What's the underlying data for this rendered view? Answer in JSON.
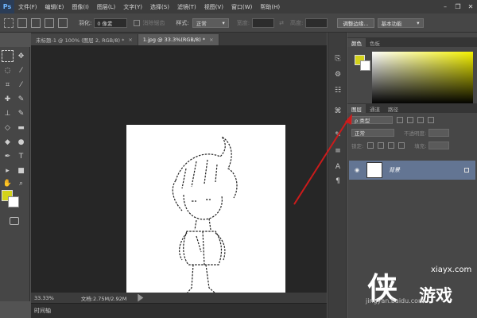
{
  "app": {
    "logo_text": "Ps"
  },
  "menu": {
    "items": [
      "文件(F)",
      "编辑(E)",
      "图像(I)",
      "图层(L)",
      "文字(Y)",
      "选择(S)",
      "滤镜(T)",
      "视图(V)",
      "窗口(W)",
      "帮助(H)"
    ]
  },
  "window_controls": {
    "minimize": "–",
    "restore": "❐",
    "close": "✕"
  },
  "options": {
    "feather_label": "羽化:",
    "feather_value": "0 像素",
    "antialias_label": "消除锯齿",
    "style_label": "样式:",
    "style_value": "正常",
    "width_label": "宽度:",
    "height_label": "高度:",
    "refine_edge": "调整边缘...",
    "workspace": "基本功能"
  },
  "tabs": [
    {
      "label": "未标题-1 @ 100% (图层 2, RGB/8) *",
      "close": "×"
    },
    {
      "label": "1.jpg @ 33.3%(RGB/8) *",
      "close": "×"
    }
  ],
  "status": {
    "zoom": "33.33%",
    "doc_size": "文档:2.75M/2.92M"
  },
  "timeline": {
    "label": "时间轴"
  },
  "colors": {
    "foreground": "#d4d31a",
    "background": "#ffffff",
    "layer_selected": "#637593",
    "arrow": "#cc1b1b"
  },
  "color_panel": {
    "tabs": [
      "颜色",
      "色板"
    ]
  },
  "layers_panel": {
    "tabs": [
      "图层",
      "通道",
      "路径"
    ],
    "filter_label": "ρ 类型",
    "blend_mode": "正常",
    "opacity_label": "不透明度:",
    "lock_label": "锁定:",
    "fill_label": "填充:",
    "layer_name": "背景"
  },
  "watermark": {
    "char": "侠",
    "domain": "xiayx.com",
    "name": "游戏",
    "sub": "jingyan.baidu.com"
  }
}
